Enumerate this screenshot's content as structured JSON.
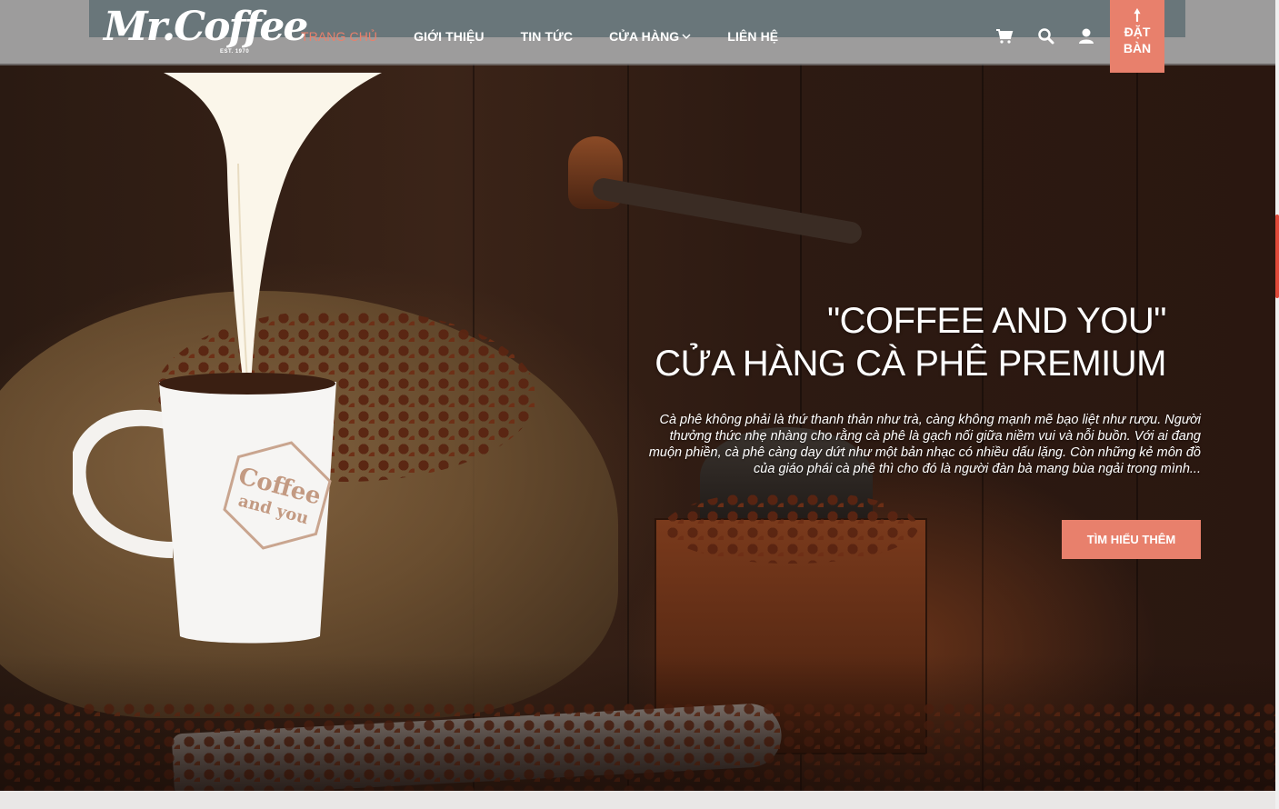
{
  "brand": {
    "logo_text": "Mr.Coffee",
    "logo_est": "EST. 1970"
  },
  "nav": {
    "items": [
      {
        "label": "TRANG CHỦ",
        "active": true
      },
      {
        "label": "GIỚI THIỆU",
        "active": false
      },
      {
        "label": "TIN TỨC",
        "active": false
      },
      {
        "label": "CỬA HÀNG",
        "active": false,
        "dropdown": true
      },
      {
        "label": "LIÊN HỆ",
        "active": false
      }
    ],
    "icons": [
      "cart-icon",
      "search-icon",
      "user-icon"
    ],
    "book_button": {
      "line1": "ĐẶT",
      "line2": "BÀN"
    }
  },
  "hero": {
    "title_line1": "\"COFFEE AND YOU\"",
    "title_line2": "CỬA HÀNG CÀ PHÊ PREMIUM",
    "description": "Cà phê không phải là thứ thanh thản như trà, càng không mạnh mẽ bạo liệt như rượu. Người thưởng thức nhẹ nhàng cho rằng cà phê là gạch nối giữa niềm vui và nỗi buồn. Với ai đang muộn phiền, cà phê càng day dứt như một bản nhạc có nhiều dấu lặng. Còn những kẻ môn đồ của giáo phái cà phê thì cho đó là người đàn bà mang bùa ngải trong mình...",
    "cta_label": "TÌM HIỂU THÊM",
    "mug_logo_line1": "Coffee",
    "mug_logo_line2": "and you"
  },
  "colors": {
    "accent": "#e8806c",
    "topbar": "#2f5f6c",
    "navbar": "#808080"
  }
}
